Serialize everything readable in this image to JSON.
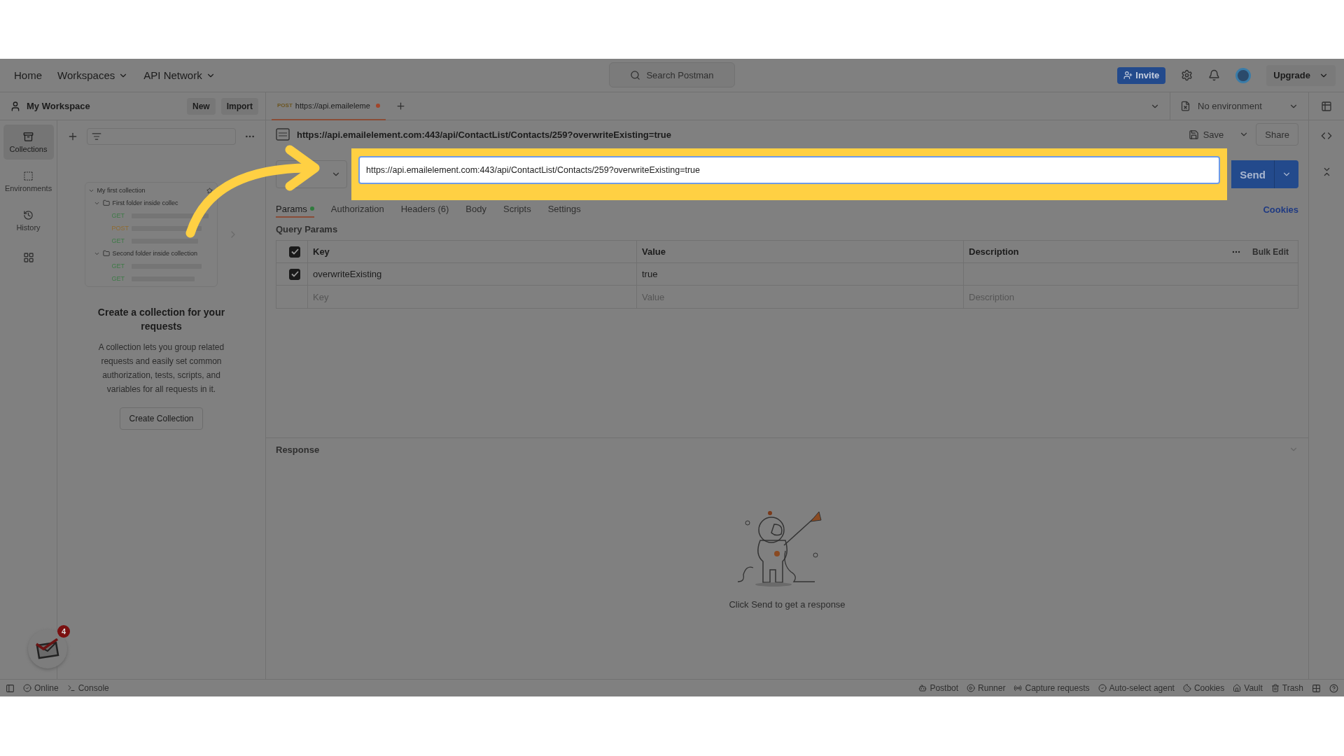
{
  "header": {
    "nav": [
      {
        "label": "Home",
        "dropdown": false
      },
      {
        "label": "Workspaces",
        "dropdown": true
      },
      {
        "label": "API Network",
        "dropdown": true
      }
    ],
    "search": {
      "placeholder": "Search Postman"
    },
    "invite": "Invite",
    "upgrade": "Upgrade"
  },
  "sidebar": {
    "workspace": "My Workspace",
    "new": "New",
    "import": "Import",
    "rail": [
      {
        "label": "Collections",
        "selected": true
      },
      {
        "label": "Environments",
        "selected": false
      },
      {
        "label": "History",
        "selected": false
      }
    ],
    "preview": {
      "name": "My first collection",
      "children": [
        {
          "name": "First folder inside collec",
          "children": [
            {
              "method": "GET"
            },
            {
              "method": "POST"
            },
            {
              "method": "GET"
            }
          ]
        },
        {
          "name": "Second folder inside collection",
          "children": [
            {
              "method": "GET"
            },
            {
              "method": "GET"
            }
          ]
        }
      ]
    },
    "empty_title": "Create a collection for your requests",
    "empty_text": "A collection lets you group related requests and easily set common authorization, tests, scripts, and variables for all requests in it.",
    "create_button": "Create Collection",
    "badge": "4"
  },
  "request_tab": {
    "method": "POST",
    "title": "https://api.emaileleme",
    "unsaved": true
  },
  "environment": "No environment",
  "request": {
    "title": "https://api.emailelement.com:443/api/ContactList/Contacts/259?overwriteExisting=true",
    "url": "https://api.emailelement.com:443/api/ContactList/Contacts/259?overwriteExisting=true",
    "save": "Save",
    "share": "Share",
    "send": "Send"
  },
  "tabs": [
    {
      "label": "Params",
      "selected": true,
      "dot": true
    },
    {
      "label": "Authorization",
      "selected": false,
      "dot": false
    },
    {
      "label": "Headers (6)",
      "selected": false,
      "dot": false
    },
    {
      "label": "Body",
      "selected": false,
      "dot": false
    },
    {
      "label": "Scripts",
      "selected": false,
      "dot": false
    },
    {
      "label": "Settings",
      "selected": false,
      "dot": false
    }
  ],
  "cookies": "Cookies",
  "params": {
    "title": "Query Params",
    "columns": [
      "Key",
      "Value",
      "Description"
    ],
    "header_checked": true,
    "bulk_edit": "Bulk Edit",
    "rows": [
      {
        "key": "overwriteExisting",
        "value": "true",
        "checked": true
      }
    ],
    "placeholders": [
      "Key",
      "Value",
      "Description"
    ]
  },
  "response": {
    "title": "Response",
    "empty": "Click Send to get a response"
  },
  "status_bar": {
    "left": [
      "Online",
      "Console"
    ],
    "right": [
      "Postbot",
      "Runner",
      "Capture requests",
      "Auto-select agent",
      "Cookies",
      "Vault",
      "Trash"
    ]
  }
}
